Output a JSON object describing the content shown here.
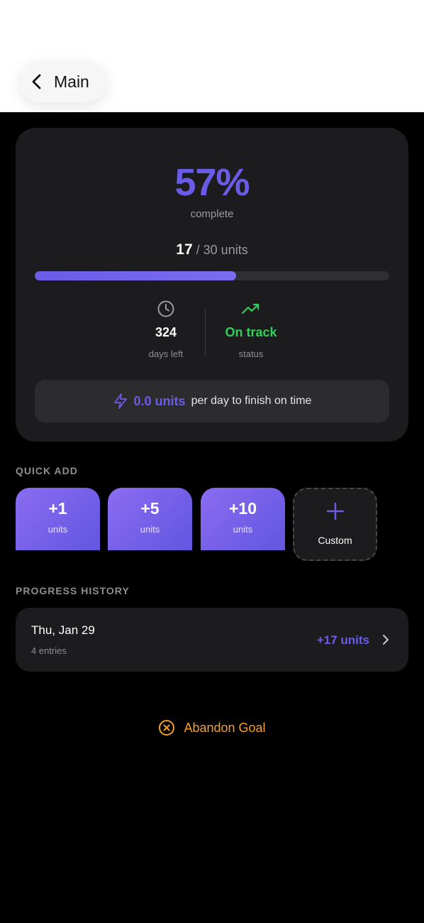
{
  "nav": {
    "back_label": "Main"
  },
  "summary": {
    "percent_text": "57%",
    "percent_label": "complete",
    "current": "17",
    "target_text": "/ 30 units",
    "progress_fraction": 0.567,
    "days_left": "324",
    "days_left_label": "days left",
    "status": "On track",
    "status_label": "status",
    "rate_value": "0.0 units",
    "rate_text": "per day to finish on time"
  },
  "quick_add": {
    "title": "QUICK ADD",
    "buttons": [
      {
        "value": "+1",
        "unit": "units"
      },
      {
        "value": "+5",
        "unit": "units"
      },
      {
        "value": "+10",
        "unit": "units"
      }
    ],
    "custom_label": "Custom"
  },
  "history": {
    "title": "PROGRESS HISTORY",
    "items": [
      {
        "date": "Thu, Jan 29",
        "entries": "4 entries",
        "amount": "+17 units"
      }
    ]
  },
  "abandon_label": "Abandon Goal",
  "colors": {
    "accent": "#6b5ce7",
    "success": "#30d158",
    "warning": "#f5a021",
    "card": "#1c1c1e"
  },
  "icons": [
    "chevron-left-icon",
    "clock-icon",
    "trending-up-icon",
    "lightning-icon",
    "plus-icon",
    "chevron-right-icon",
    "x-circle-icon"
  ]
}
